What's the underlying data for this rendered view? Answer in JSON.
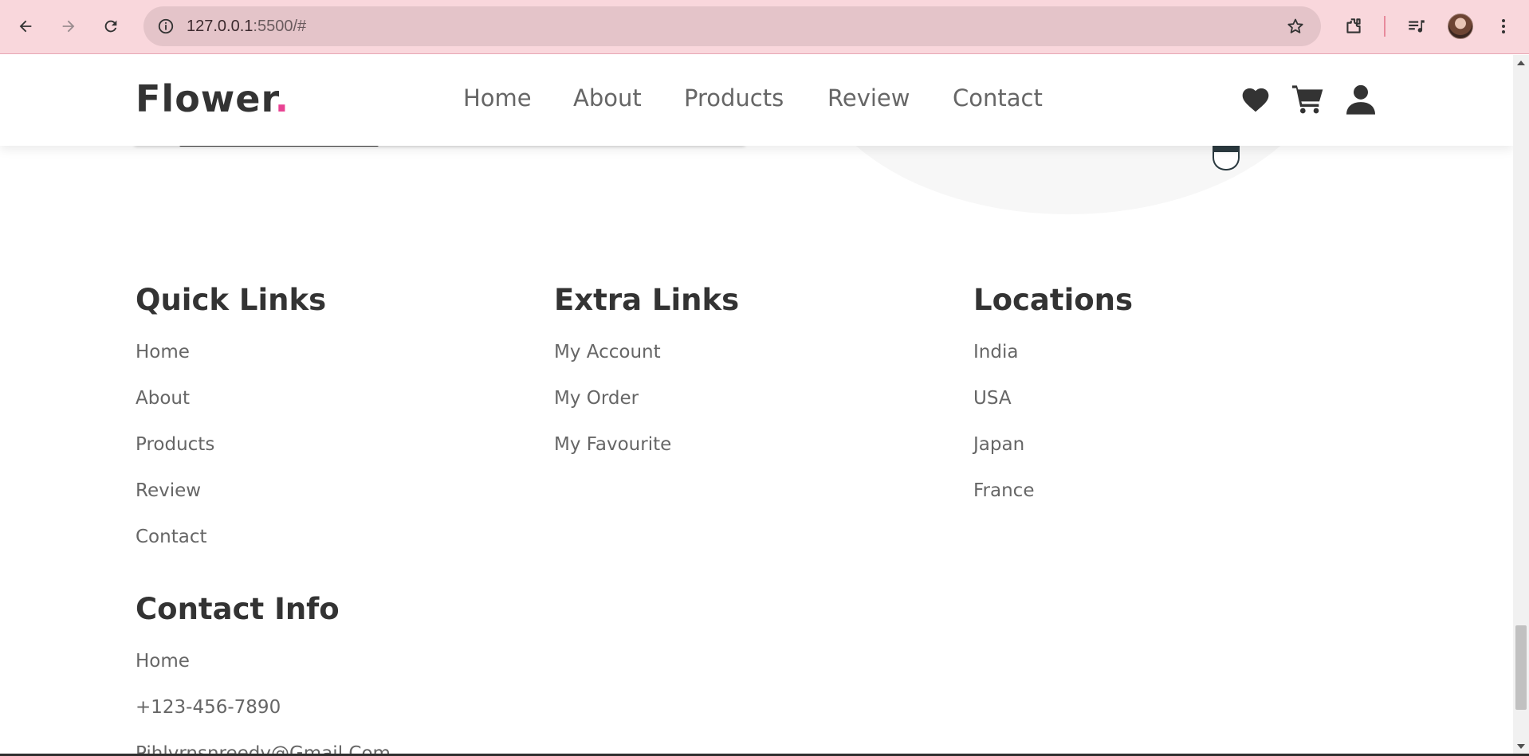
{
  "browser": {
    "url_host": "127.0.0.1",
    "url_rest": ":5500/#",
    "icons": [
      "back-arrow-icon",
      "forward-arrow-icon",
      "reload-icon",
      "site-info-icon",
      "bookmark-star-icon",
      "extensions-icon",
      "media-control-icon",
      "profile-avatar",
      "more-vert-icon"
    ]
  },
  "header": {
    "logo_text": "Flower",
    "logo_dot": ".",
    "nav": [
      "Home",
      "About",
      "Products",
      "Review",
      "Contact"
    ],
    "icons": [
      "heart-icon",
      "cart-icon",
      "user-icon"
    ]
  },
  "footer": {
    "quick_links": {
      "title": "Quick Links",
      "links": [
        "Home",
        "About",
        "Products",
        "Review",
        "Contact"
      ]
    },
    "extra_links": {
      "title": "Extra Links",
      "links": [
        "My Account",
        "My Order",
        "My Favourite"
      ]
    },
    "locations": {
      "title": "Locations",
      "links": [
        "India",
        "USA",
        "Japan",
        "France"
      ]
    },
    "contact_info": {
      "title": "Contact Info",
      "links": [
        "Home",
        "+123-456-7890",
        "Pihlvrnsnreedv@Gmail.Com"
      ]
    }
  },
  "colors": {
    "accent": "#e84393",
    "text_dark": "#333333",
    "text_light": "#666666",
    "browser_frame": "#f9d7dc"
  }
}
